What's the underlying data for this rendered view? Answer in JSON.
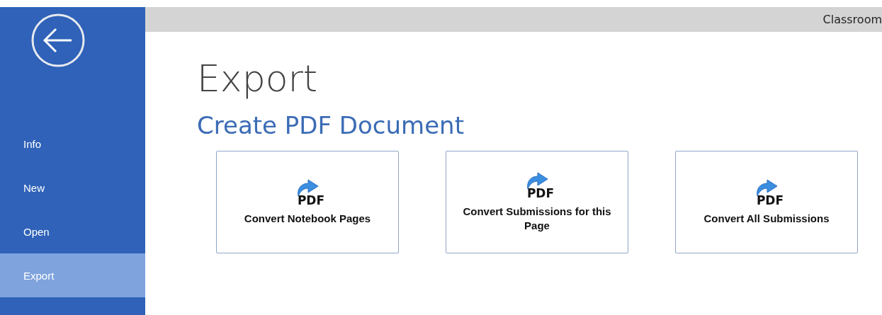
{
  "sidebar": {
    "items": [
      {
        "label": "Info",
        "selected": false
      },
      {
        "label": "New",
        "selected": false
      },
      {
        "label": "Open",
        "selected": false
      },
      {
        "label": "Export",
        "selected": true
      }
    ]
  },
  "header": {
    "title": "Classroom"
  },
  "page": {
    "title": "Export",
    "section": "Create PDF Document"
  },
  "actions": [
    {
      "icon_label": "PDF",
      "label": "Convert Notebook Pages"
    },
    {
      "icon_label": "PDF",
      "label": "Convert Submissions for this Page"
    },
    {
      "icon_label": "PDF",
      "label": "Convert All Submissions"
    }
  ]
}
